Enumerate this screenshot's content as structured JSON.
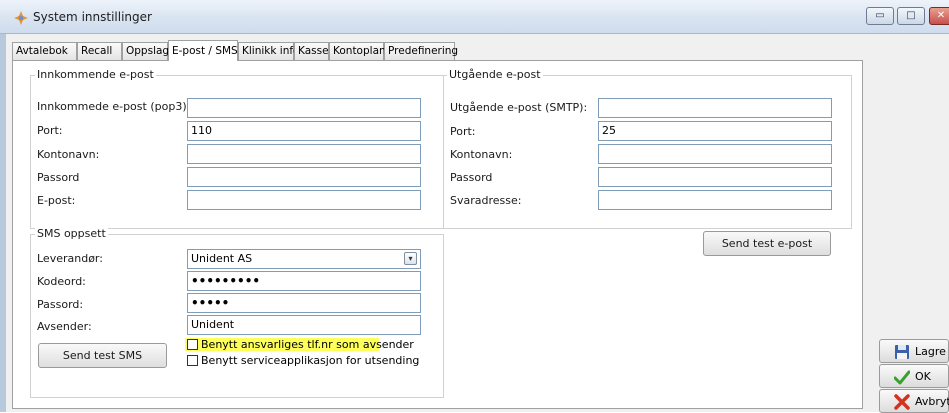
{
  "window": {
    "title": "System innstillinger",
    "min_glyph": "▭",
    "max_glyph": "□",
    "close_glyph": "✕"
  },
  "tabs": [
    {
      "label": "Avtalebok"
    },
    {
      "label": "Recall"
    },
    {
      "label": "Oppslag"
    },
    {
      "label": "E-post / SMS"
    },
    {
      "label": "Klinikk info"
    },
    {
      "label": "Kasse"
    },
    {
      "label": "Kontoplan"
    },
    {
      "label": "Predefinering"
    }
  ],
  "active_tab": "E-post / SMS",
  "incoming": {
    "title": "Innkommende e-post",
    "pop3_label": "Innkommede e-post (pop3):",
    "pop3_value": "",
    "port_label": "Port:",
    "port_value": "110",
    "account_label": "Kontonavn:",
    "account_value": "",
    "password_label": "Passord",
    "password_value": "",
    "email_label": "E-post:",
    "email_value": ""
  },
  "outgoing": {
    "title": "Utgående e-post",
    "smtp_label": "Utgående e-post (SMTP):",
    "smtp_value": "",
    "port_label": "Port:",
    "port_value": "25",
    "account_label": "Kontonavn:",
    "account_value": "",
    "password_label": "Passord",
    "password_value": "",
    "reply_label": "Svaradresse:",
    "reply_value": "",
    "send_test_label": "Send test e-post"
  },
  "sms": {
    "title": "SMS oppsett",
    "provider_label": "Leverandør:",
    "provider_value": "Unident AS",
    "code_label": "Kodeord:",
    "code_value": "•••••••••",
    "password_label": "Passord:",
    "password_value": "•••••",
    "sender_label": "Avsender:",
    "sender_value": "Unident",
    "send_test_label": "Send test SMS",
    "use_responsible_label": "Benytt ansvarliges tlf.nr som avsender",
    "use_responsible_checked": false,
    "use_service_label": "Benytt serviceapplikasjon for utsending",
    "use_service_checked": false
  },
  "actions": {
    "save_label": "Lagre",
    "ok_label": "OK",
    "cancel_label": "Avbryt"
  },
  "colors": {
    "highlight": "#ffff59",
    "accent": "#7f9db9"
  }
}
